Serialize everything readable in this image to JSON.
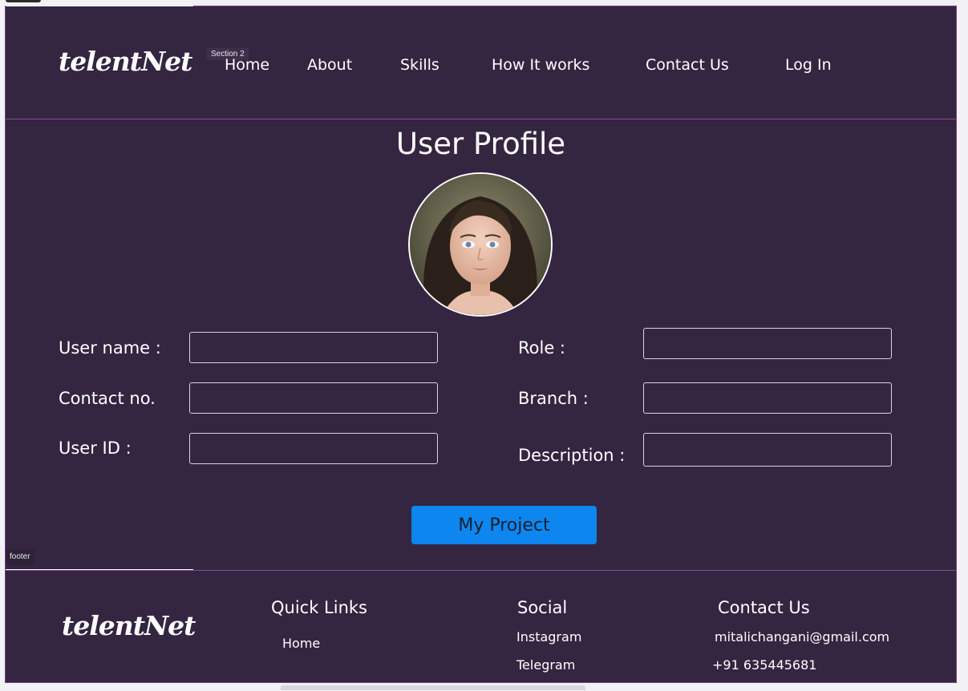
{
  "brand": {
    "logo_text": "telentNet"
  },
  "editor_tags": {
    "section": "Section 2",
    "footer": "footer"
  },
  "nav": {
    "items": [
      {
        "label": "Home"
      },
      {
        "label": "About"
      },
      {
        "label": "Skills"
      },
      {
        "label": "How It works"
      },
      {
        "label": "Contact Us"
      },
      {
        "label": "Log In"
      }
    ]
  },
  "profile": {
    "title": "User Profile",
    "fields": {
      "username": {
        "label": "User name :",
        "value": ""
      },
      "contact": {
        "label": "Contact no.",
        "value": ""
      },
      "userid": {
        "label": "User ID :",
        "value": ""
      },
      "role": {
        "label": "Role :",
        "value": ""
      },
      "branch": {
        "label": "Branch :",
        "value": ""
      },
      "description": {
        "label": "Description :",
        "value": ""
      }
    },
    "button_label": "My Project"
  },
  "footer": {
    "quick_links": {
      "heading": "Quick Links",
      "items": [
        "Home"
      ]
    },
    "social": {
      "heading": "Social",
      "items": [
        "Instagram",
        "Telegram"
      ]
    },
    "contact": {
      "heading": "Contact Us",
      "email": "mitalichangani@gmail.com",
      "phone": "+91 635445681"
    }
  },
  "colors": {
    "background": "#342541",
    "border_accent": "#8a4a9a",
    "button": "#0d86f0",
    "text": "#ffffff"
  },
  "icons": {
    "avatar": "profile-photo"
  }
}
